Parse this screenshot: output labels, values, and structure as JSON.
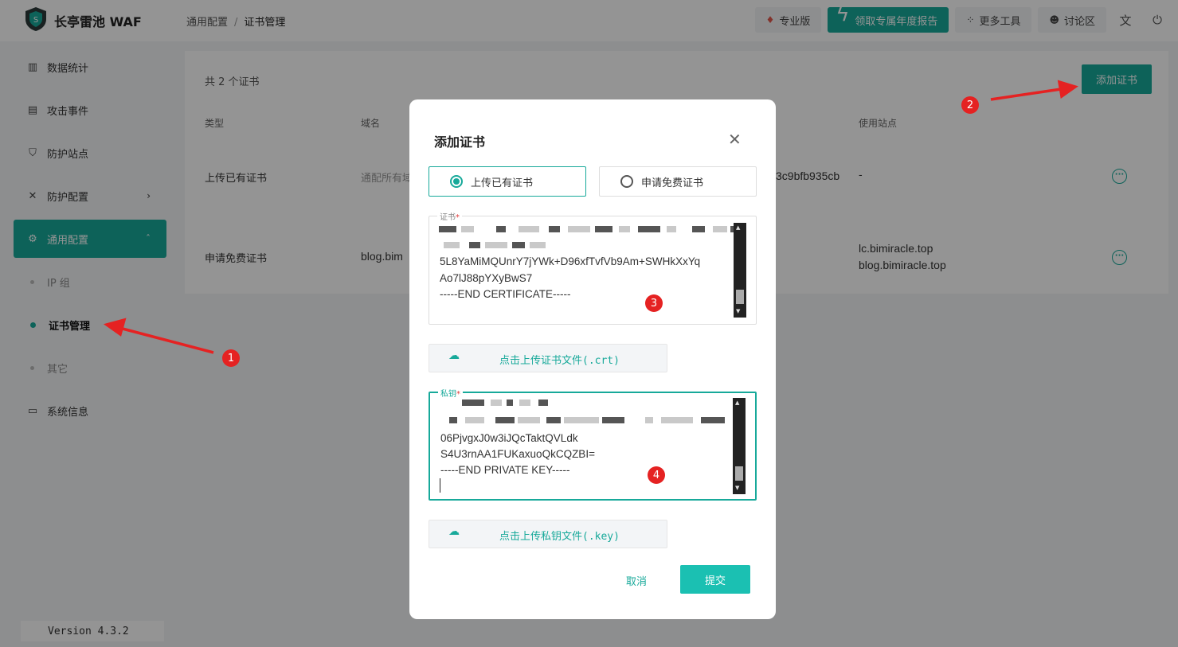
{
  "app": {
    "title": "长亭雷池 WAF",
    "version": "Version 4.3.2"
  },
  "breadcrumb": {
    "parent": "通用配置",
    "separator": "/",
    "current": "证书管理"
  },
  "topbar": {
    "pro_label": "专业版",
    "report_label": "领取专属年度报告",
    "tools_label": "更多工具",
    "forum_label": "讨论区"
  },
  "sidebar": {
    "items": [
      {
        "label": "数据统计",
        "icon": "bar-chart-icon"
      },
      {
        "label": "攻击事件",
        "icon": "event-log-icon"
      },
      {
        "label": "防护站点",
        "icon": "shield-icon"
      },
      {
        "label": "防护配置",
        "icon": "tools-icon"
      },
      {
        "label": "通用配置",
        "icon": "gear-icon"
      },
      {
        "label": "系统信息",
        "icon": "monitor-icon"
      }
    ],
    "subitems": [
      {
        "label": "IP 组"
      },
      {
        "label": "证书管理"
      },
      {
        "label": "其它"
      }
    ]
  },
  "list": {
    "total": "共 2 个证书",
    "add_button": "添加证书",
    "headers": {
      "type": "类型",
      "domain": "域名",
      "sites": "使用站点"
    },
    "rows": [
      {
        "type": "上传已有证书",
        "domain": "通配所有域",
        "fingerprint": "3c9bfb935cb",
        "sites": "-"
      },
      {
        "type": "申请免费证书",
        "domain": "blog.bim",
        "sites_line1": "lc.bimiracle.top",
        "sites_line2": "blog.bimiracle.top"
      }
    ]
  },
  "modal": {
    "title": "添加证书",
    "options": {
      "upload": "上传已有证书",
      "apply": "申请免费证书"
    },
    "cert": {
      "label": "证书",
      "required": "*",
      "lines": [
        "5L8YaMiMQUnrY7jYWk+D96xfTvfVb9Am+SWHkXxYq",
        "Ao7lJ88pYXyBwS7",
        "-----END CERTIFICATE-----"
      ],
      "upload_label": "点击上传证书文件(.crt)"
    },
    "key": {
      "label": "私钥",
      "required": "*",
      "lines": [
        "06PjvgxJ0w3iJQcTaktQVLdk",
        "S4U3rnAA1FUKaxuoQkCQZBI=",
        "-----END PRIVATE KEY-----"
      ],
      "upload_label": "点击上传私钥文件(.key)"
    },
    "cancel": "取消",
    "submit": "提交"
  },
  "annotations": {
    "badge1": "1",
    "badge2": "2",
    "badge3": "3",
    "badge4": "4"
  },
  "colors": {
    "accent": "#17a99a",
    "annotation": "#e52222"
  }
}
